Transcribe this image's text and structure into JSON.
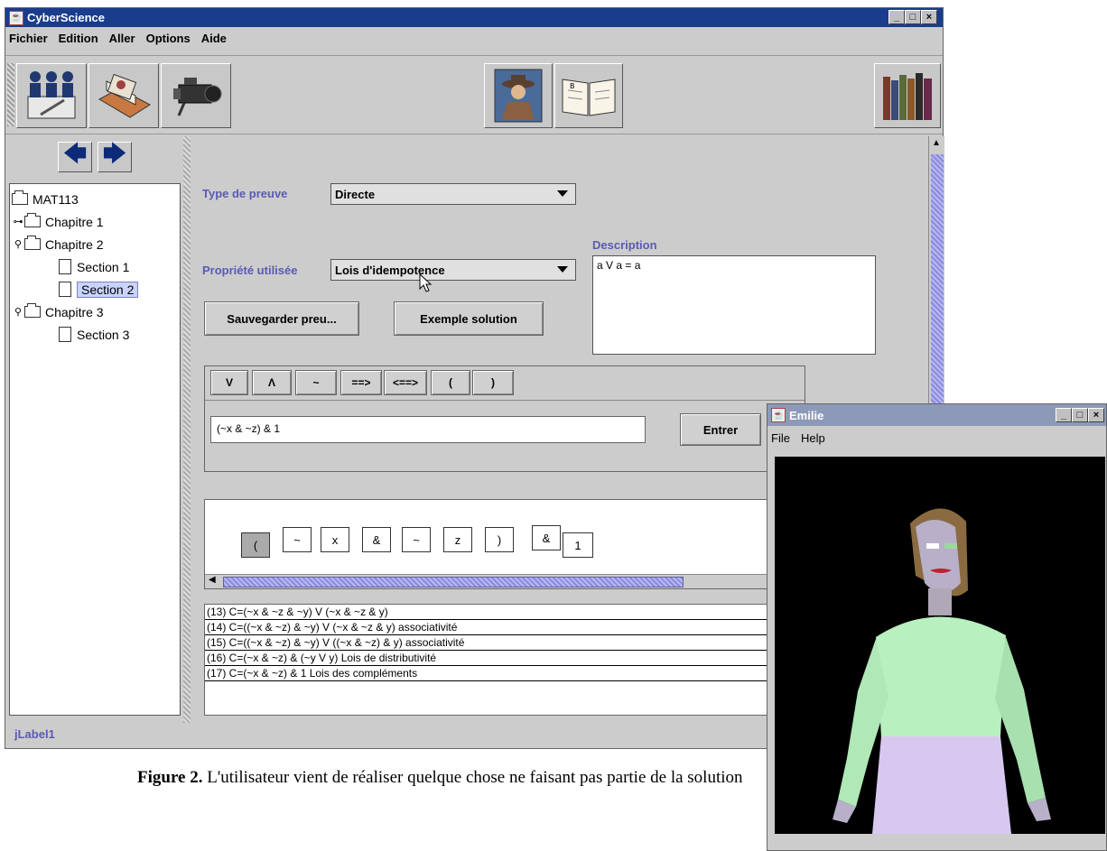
{
  "main_window": {
    "title": "CyberScience",
    "menu": [
      "Fichier",
      "Edition",
      "Aller",
      "Options",
      "Aide"
    ],
    "toolbar_icons": [
      "meeting-icon",
      "card-file-icon",
      "video-camera-icon",
      "cowboy-portrait-icon",
      "open-book-icon",
      "bookshelf-icon"
    ]
  },
  "tree": {
    "root": "MAT113",
    "items": [
      {
        "label": "Chapitre 1",
        "type": "folder",
        "state": "collapsed"
      },
      {
        "label": "Chapitre 2",
        "type": "folder",
        "state": "expanded"
      },
      {
        "label": "Section 1",
        "type": "page"
      },
      {
        "label": "Section 2",
        "type": "page",
        "selected": true
      },
      {
        "label": "Chapitre 3",
        "type": "folder",
        "state": "expanded"
      },
      {
        "label": "Section 3",
        "type": "page"
      }
    ]
  },
  "form": {
    "type_label": "Type de preuve",
    "type_value": "Directe",
    "property_label": "Propriété utilisée",
    "property_value": "Lois d'idempotence",
    "description_label": "Description",
    "description_text": "a V a = a",
    "save_button": "Sauvegarder preu...",
    "example_button": "Exemple solution"
  },
  "operators": [
    "V",
    "Λ",
    "~",
    "==>",
    "<==>",
    "(",
    ")"
  ],
  "input": {
    "value": "(~x & ~z) & 1",
    "enter_button": "Entrer"
  },
  "tokens": [
    "(",
    "~",
    "x",
    "&",
    "~",
    "z",
    ")",
    "&",
    "1"
  ],
  "steps": [
    "(13)  C=(~x & ~z & ~y) V (~x & ~z & y)",
    "(14)  C=((~x & ~z) & ~y) V (~x & ~z & y)   associativité",
    "(15)  C=((~x & ~z) & ~y) V ((~x & ~z) & y)   associativité",
    "(16)  C=(~x & ~z) & (~y V y)   Lois de distributivité",
    "(17)  C=(~x & ~z) & 1   Lois des compléments"
  ],
  "status": "jLabel1",
  "caption": {
    "bold": "Figure 2.",
    "text": " L'utilisateur vient de réaliser quelque chose ne faisant pas partie de la solution"
  },
  "emilie_window": {
    "title": "Emilie",
    "menu": [
      "File",
      "Help"
    ]
  },
  "colors": {
    "title_active": "#1a3c8c",
    "title_inactive": "#8c9ab8",
    "label": "#5a5ab4",
    "selection": "#c8d4ff"
  }
}
